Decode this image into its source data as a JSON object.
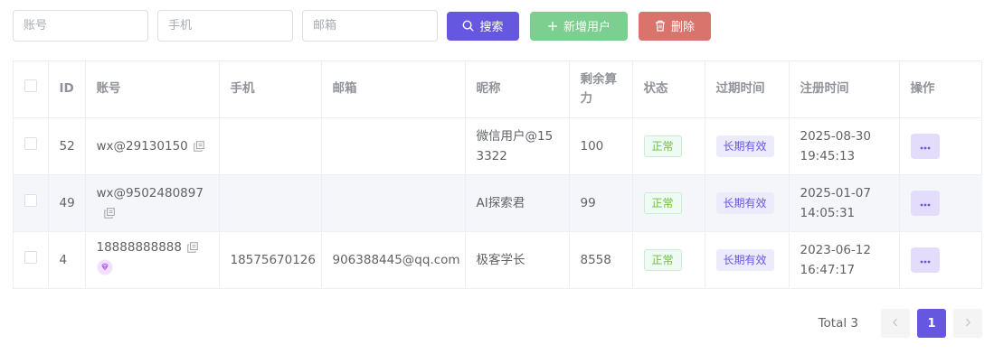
{
  "filters": {
    "account_placeholder": "账号",
    "phone_placeholder": "手机",
    "email_placeholder": "邮箱",
    "search_label": "搜索",
    "add_label": "新增用户",
    "delete_label": "删除"
  },
  "table": {
    "headers": [
      "ID",
      "账号",
      "手机",
      "邮箱",
      "昵称",
      "剩余算力",
      "状态",
      "过期时间",
      "注册时间",
      "操作"
    ],
    "rows": [
      {
        "id": "52",
        "account": "wx@29130150",
        "phone": "",
        "email": "",
        "nickname": "微信用户@153322",
        "power": "100",
        "status": "正常",
        "expire": "长期有效",
        "registered": "2025-08-30 19:45:13",
        "vip": false
      },
      {
        "id": "49",
        "account": "wx@9502480897",
        "phone": "",
        "email": "",
        "nickname": "AI探索君",
        "power": "99",
        "status": "正常",
        "expire": "长期有效",
        "registered": "2025-01-07 14:05:31",
        "vip": false
      },
      {
        "id": "4",
        "account": "18888888888",
        "phone": "18575670126",
        "email": "906388445@qq.com",
        "nickname": "极客学长",
        "power": "8558",
        "status": "正常",
        "expire": "长期有效",
        "registered": "2023-06-12 16:47:17",
        "vip": true
      }
    ]
  },
  "pagination": {
    "total_text": "Total 3",
    "current_page": "1"
  },
  "icons": {
    "search": "search-icon",
    "add": "plus-icon",
    "delete": "trash-icon",
    "copy": "copy-icon",
    "vip": "diamond-icon",
    "more": "more-dots-icon",
    "prev": "chevron-left-icon",
    "next": "chevron-right-icon"
  },
  "colors": {
    "primary": "#6657e0",
    "success": "#7ccf8e",
    "danger": "#d9746d",
    "tag_ok_text": "#67c23a",
    "vip": "#b05df0"
  }
}
